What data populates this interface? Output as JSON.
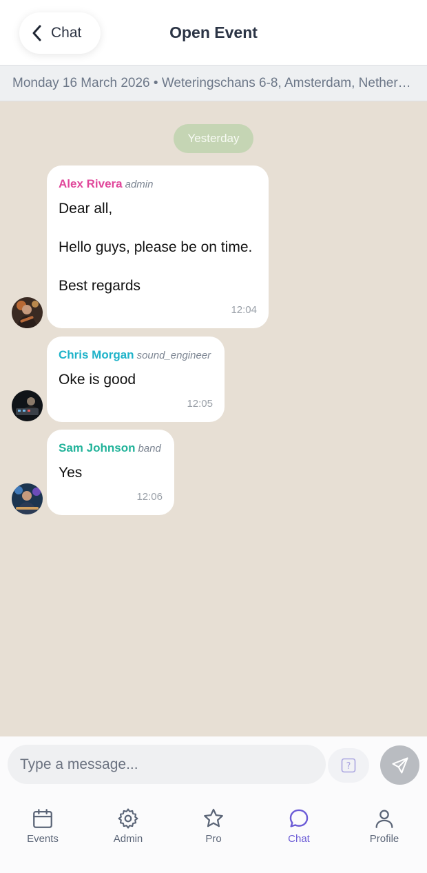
{
  "header": {
    "back_label": "Chat",
    "title": "Open Event"
  },
  "event_info": "Monday 16 March 2026 • Weteringschans 6-8, Amsterdam, Nether…",
  "chat": {
    "day_separator": "Yesterday",
    "messages": [
      {
        "sender": "Alex Rivera",
        "role": "admin",
        "sender_color": "#e0469a",
        "lines": [
          "Dear all,",
          "",
          "Hello guys, please be on time.",
          "",
          "Best regards"
        ],
        "time": "12:04"
      },
      {
        "sender": "Chris Morgan",
        "role": "sound_engineer",
        "sender_color": "#1fb3c9",
        "lines": [
          "Oke is good"
        ],
        "time": "12:05"
      },
      {
        "sender": "Sam Johnson",
        "role": "band",
        "sender_color": "#22b39a",
        "lines": [
          "Yes"
        ],
        "time": "12:06"
      }
    ]
  },
  "composer": {
    "placeholder": "Type a message..."
  },
  "tabs": [
    {
      "label": "Events",
      "icon": "calendar-icon"
    },
    {
      "label": "Admin",
      "icon": "gear-icon"
    },
    {
      "label": "Pro",
      "icon": "star-icon"
    },
    {
      "label": "Chat",
      "icon": "chat-bubble-icon",
      "active": true
    },
    {
      "label": "Profile",
      "icon": "user-icon"
    }
  ],
  "colors": {
    "chat_background": "#e7dfd4",
    "active_tab": "#6b5bd6",
    "day_pill": "#c5d5b4"
  }
}
